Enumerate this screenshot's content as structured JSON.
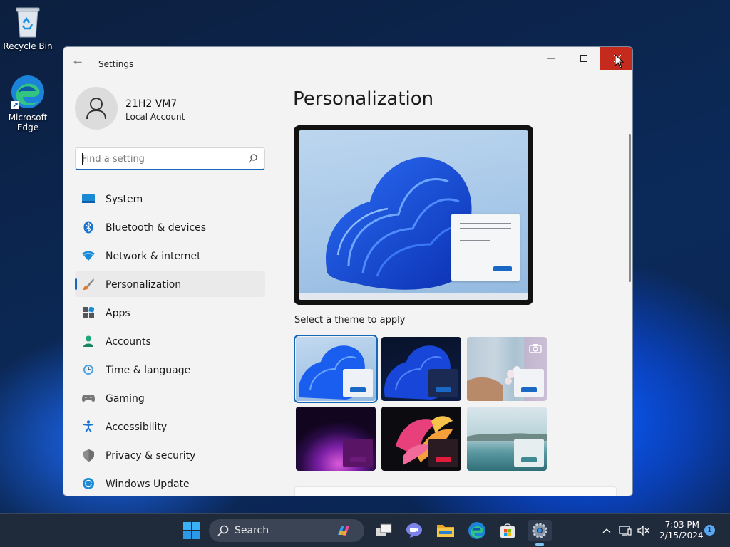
{
  "desktop": {
    "icons": [
      {
        "label": "Recycle Bin"
      },
      {
        "label": "Microsoft Edge"
      }
    ]
  },
  "window": {
    "title": "Settings",
    "user": {
      "name": "21H2 VM7",
      "account_type": "Local Account"
    },
    "search": {
      "placeholder": "Find a setting",
      "value": ""
    },
    "nav": [
      {
        "label": "System",
        "icon": "system-icon"
      },
      {
        "label": "Bluetooth & devices",
        "icon": "bluetooth-icon"
      },
      {
        "label": "Network & internet",
        "icon": "wifi-icon"
      },
      {
        "label": "Personalization",
        "icon": "brush-icon",
        "selected": true
      },
      {
        "label": "Apps",
        "icon": "apps-icon"
      },
      {
        "label": "Accounts",
        "icon": "accounts-icon"
      },
      {
        "label": "Time & language",
        "icon": "clock-icon"
      },
      {
        "label": "Gaming",
        "icon": "gamepad-icon"
      },
      {
        "label": "Accessibility",
        "icon": "accessibility-icon"
      },
      {
        "label": "Privacy & security",
        "icon": "shield-icon"
      },
      {
        "label": "Windows Update",
        "icon": "update-icon"
      }
    ],
    "page_title": "Personalization",
    "themes_heading": "Select a theme to apply"
  },
  "taskbar": {
    "search_label": "Search",
    "time": "7:03 PM",
    "date": "2/15/2024",
    "notification_count": "1"
  },
  "colors": {
    "accent": "#1667b8",
    "close_hover": "#c42b1c"
  }
}
